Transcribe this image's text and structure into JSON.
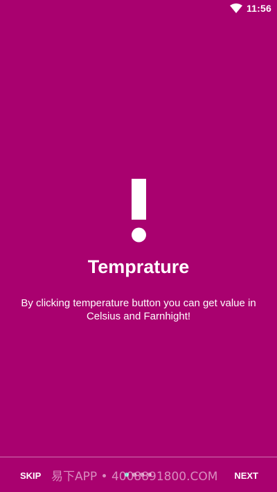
{
  "status_bar": {
    "time": "11:56",
    "wifi_icon": "wifi-icon"
  },
  "slide": {
    "icon": "exclamation-icon",
    "title": "Temprature",
    "description": "By clicking temperature button you can get value in Celsius and Farnhight!"
  },
  "footer": {
    "skip_label": "SKIP",
    "next_label": "NEXT",
    "page_indicator": {
      "total": 4,
      "active": 1
    },
    "watermark": "易下APP • 4008891800.COM"
  },
  "colors": {
    "background": "#a9016f",
    "text": "#ffffff",
    "active_dot": "#7fe0d0"
  }
}
